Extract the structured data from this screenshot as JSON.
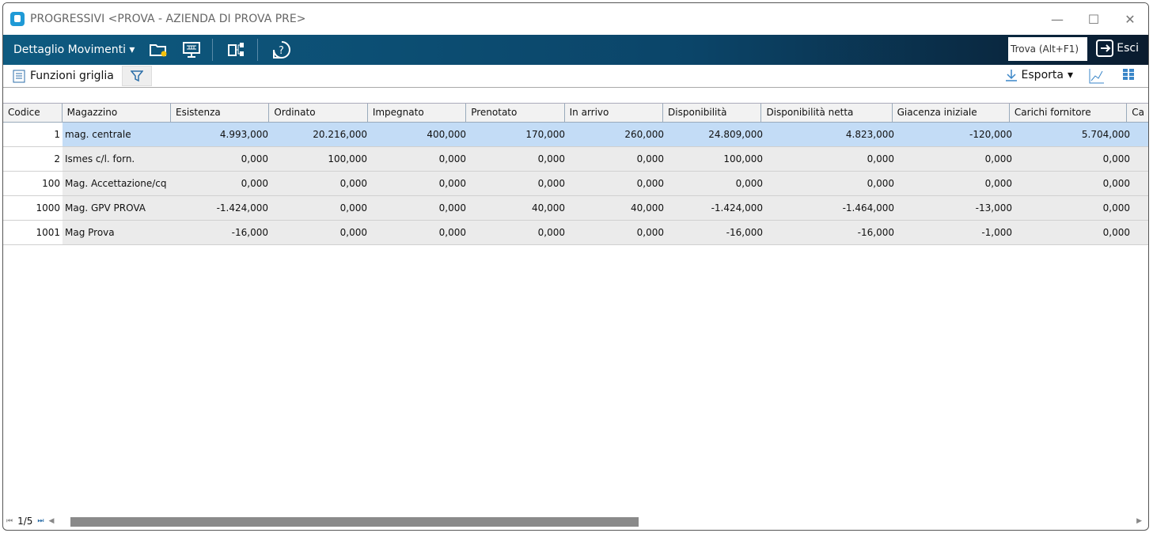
{
  "window": {
    "title": "PROGRESSIVI <PROVA - AZIENDA DI PROVA PRE>"
  },
  "toolbar": {
    "menu": "Dettaglio Movimenti",
    "search_placeholder": "Trova (Alt+F1)",
    "exit": "Esci"
  },
  "subbar": {
    "grid_functions": "Funzioni griglia",
    "export": "Esporta"
  },
  "columns": [
    "Codice",
    "Magazzino",
    "Esistenza",
    "Ordinato",
    "Impegnato",
    "Prenotato",
    "In arrivo",
    "Disponibilità",
    "Disponibilità netta",
    "Giacenza iniziale",
    "Carichi fornitore",
    "Ca"
  ],
  "rows": [
    [
      "1",
      "mag. centrale",
      "4.993,000",
      "20.216,000",
      "400,000",
      "170,000",
      "260,000",
      "24.809,000",
      "4.823,000",
      "-120,000",
      "5.704,000"
    ],
    [
      "2",
      "Ismes c/l. forn.",
      "0,000",
      "100,000",
      "0,000",
      "0,000",
      "0,000",
      "100,000",
      "0,000",
      "0,000",
      "0,000"
    ],
    [
      "100",
      "Mag. Accettazione/cq",
      "0,000",
      "0,000",
      "0,000",
      "0,000",
      "0,000",
      "0,000",
      "0,000",
      "0,000",
      "0,000"
    ],
    [
      "1000",
      "Mag. GPV PROVA",
      "-1.424,000",
      "0,000",
      "0,000",
      "40,000",
      "40,000",
      "-1.424,000",
      "-1.464,000",
      "-13,000",
      "0,000"
    ],
    [
      "1001",
      "Mag Prova",
      "-16,000",
      "0,000",
      "0,000",
      "0,000",
      "0,000",
      "-16,000",
      "-16,000",
      "-1,000",
      "0,000"
    ]
  ],
  "footer": {
    "page": "1/5"
  }
}
